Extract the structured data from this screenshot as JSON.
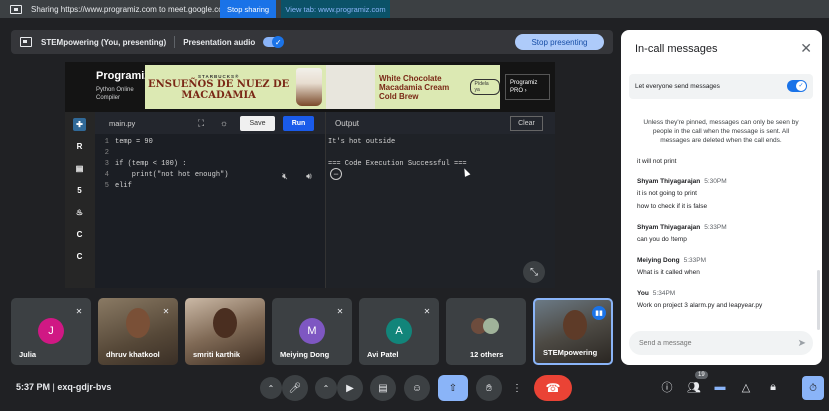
{
  "share_bar": {
    "text": "Sharing https://www.programiz.com to meet.google.com",
    "stop_sharing": "Stop sharing",
    "view_tab": "View tab: www.programiz.com"
  },
  "present_bar": {
    "name": "STEMpowering (You, presenting)",
    "audio_label": "Presentation audio",
    "stop_button": "Stop presenting"
  },
  "programiz": {
    "logo": "Programiz",
    "subtitle": "Python Online Compiler",
    "pro": "Programiz PRO ›",
    "ad": {
      "brand": "STARBUCKS®",
      "title": "ENSUEÑOS DE NUEZ DE MACADAMIA",
      "product": "White Chocolate Macadamia Cream Cold Brew",
      "cta": "Pídela ya"
    },
    "tab": "main.py",
    "save": "Save",
    "run": "Run",
    "output_label": "Output",
    "clear": "Clear",
    "code": [
      {
        "n": "1",
        "text": "temp = 90"
      },
      {
        "n": "2",
        "text": ""
      },
      {
        "n": "3",
        "text": "if (temp < 100) :"
      },
      {
        "n": "4",
        "text": "    print(\"not hot enough\")"
      },
      {
        "n": "5",
        "text": "elif"
      }
    ],
    "output": [
      "It's hot outside",
      "",
      "=== Code Execution Successful ==="
    ]
  },
  "participants": [
    {
      "name": "Julia",
      "initial": "J",
      "color": "#d01884"
    },
    {
      "name": "dhruv khatkool",
      "initial": ""
    },
    {
      "name": "smriti karthik",
      "initial": ""
    },
    {
      "name": "Meiying Dong",
      "initial": "M",
      "color": "#7e57c2"
    },
    {
      "name": "Avi Patel",
      "initial": "A",
      "color": "#12857a"
    },
    {
      "name": "12 others",
      "initial": ""
    },
    {
      "name": "STEMpowering",
      "initial": ""
    }
  ],
  "bottom": {
    "time": "5:37 PM",
    "code": "exq-gdjr-bvs",
    "participants_count": "19"
  },
  "chat": {
    "title": "In-call messages",
    "setting": "Let everyone send messages",
    "pin_note": "Unless they're pinned, messages can only be seen by people in the call when the message is sent. All messages are deleted when the call ends.",
    "partial": "it will not print",
    "messages": [
      {
        "sender": "Shyam Thiyagarajan",
        "time": "5:30PM",
        "lines": [
          "it is not going to print",
          "how to check if it is false"
        ]
      },
      {
        "sender": "Shyam Thiyagarajan",
        "time": "5:33PM",
        "lines": [
          "can you do  !temp"
        ]
      },
      {
        "sender": "Meiying Dong",
        "time": "5:33PM",
        "lines": [
          "What is it called when"
        ]
      },
      {
        "sender": "You",
        "time": "5:34PM",
        "lines": [
          "Work on project 3 alarm.py and leapyear.py"
        ]
      }
    ],
    "placeholder": "Send a message"
  }
}
